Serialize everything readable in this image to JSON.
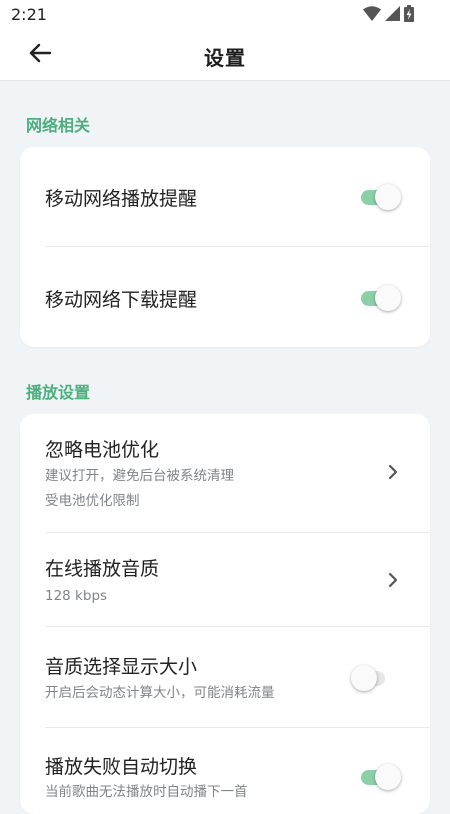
{
  "status_bar": {
    "time": "2:21",
    "icons": [
      "wifi-icon",
      "cell-signal-icon",
      "battery-charging-icon"
    ]
  },
  "app_bar": {
    "title": "设置",
    "back_icon": "arrow-left-icon"
  },
  "sections": [
    {
      "title": "网络相关",
      "items": [
        {
          "label": "移动网络播放提醒",
          "control": "switch",
          "on": true
        },
        {
          "label": "移动网络下载提醒",
          "control": "switch",
          "on": true
        }
      ]
    },
    {
      "title": "播放设置",
      "items": [
        {
          "label": "忽略电池优化",
          "desc_line1": "建议打开，避免后台被系统清理",
          "desc_line2": "受电池优化限制",
          "control": "chevron"
        },
        {
          "label": "在线播放音质",
          "desc_line1": "128 kbps",
          "control": "chevron"
        },
        {
          "label": "音质选择显示大小",
          "desc_line1": "开启后会动态计算大小，可能消耗流量",
          "control": "switch",
          "on": false
        },
        {
          "label": "播放失败自动切换",
          "desc_line1": "当前歌曲无法播放时自动播下一首",
          "control": "switch",
          "on": true
        }
      ]
    }
  ],
  "colors": {
    "accent": "#4caf7d",
    "switch_on_track": "#8bd0a9",
    "background": "#f1f4f7",
    "card": "#ffffff"
  }
}
